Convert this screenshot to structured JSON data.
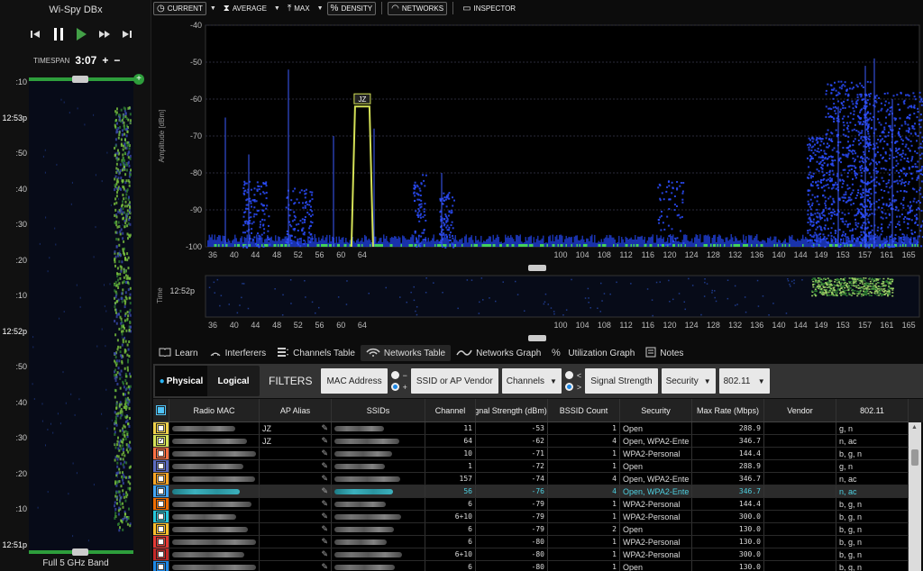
{
  "app": {
    "title": "Wi-Spy DBx"
  },
  "transport": {
    "prev": "skip-back",
    "pause": "pause",
    "play": "play",
    "ffwd": "fast-forward",
    "next": "skip-forward"
  },
  "timespan": {
    "label": "TIMESPAN",
    "value": "3:07",
    "plus": "+",
    "minus": "−"
  },
  "left_waterfall": {
    "time_labels": [
      ":10",
      "12:53p",
      ":50",
      ":40",
      ":30",
      ":20",
      ":10",
      "12:52p",
      ":50",
      ":40",
      ":30",
      ":20",
      ":10",
      "12:51p"
    ],
    "band_label": "Full 5 GHz Band"
  },
  "toolbar": {
    "current": "CURRENT",
    "average": "AVERAGE",
    "max": "MAX",
    "density": "DENSITY",
    "networks": "NETWORKS",
    "inspector": "INSPECTOR"
  },
  "spectrum": {
    "ylabel": "Amplitude [dBm]",
    "y_ticks": [
      "-40",
      "-50",
      "-60",
      "-70",
      "-80",
      "-90",
      "-100"
    ],
    "ylim": [
      -100,
      -40
    ],
    "x_ticks": [
      "36",
      "40",
      "44",
      "48",
      "52",
      "56",
      "60",
      "64",
      "100",
      "104",
      "108",
      "112",
      "116",
      "120",
      "124",
      "128",
      "132",
      "136",
      "140",
      "144",
      "149",
      "153",
      "157",
      "161",
      "165"
    ],
    "network_marker": {
      "label": "JZ",
      "channel": 64,
      "amplitude": -62
    }
  },
  "waterfall2": {
    "ylabel": "Time",
    "time_label": "12:52p"
  },
  "tabs": [
    {
      "label": "Learn",
      "icon": "book-icon"
    },
    {
      "label": "Interferers",
      "icon": "interferers-icon"
    },
    {
      "label": "Channels Table",
      "icon": "channels-table-icon"
    },
    {
      "label": "Networks Table",
      "icon": "wifi-icon"
    },
    {
      "label": "Networks Graph",
      "icon": "graph-icon"
    },
    {
      "label": "Utilization Graph",
      "icon": "utilization-icon"
    },
    {
      "label": "Notes",
      "icon": "notes-icon"
    }
  ],
  "filters": {
    "physical": "Physical",
    "logical": "Logical",
    "label": "FILTERS",
    "mac": "MAC Address",
    "radio1_a": "−",
    "radio1_b": "+",
    "ssid": "SSID or AP Vendor",
    "channels": "Channels",
    "radio2_a": "<",
    "radio2_b": ">",
    "signal": "Signal Strength",
    "security": "Security",
    "phy": "802.11"
  },
  "table": {
    "headers": [
      "Radio MAC",
      "AP Alias",
      "SSIDs",
      "Channel",
      "Signal Strength (dBm)",
      "BSSID Count",
      "Security",
      "Max Rate (Mbps)",
      "Vendor",
      "802.11"
    ],
    "rows": [
      {
        "color": "#f0d24a",
        "checked": false,
        "alias": "JZ",
        "channel": "11",
        "signal": "-53",
        "bssid": "1",
        "security": "Open",
        "rate": "288.9",
        "phy": "g, n"
      },
      {
        "color": "#d4e157",
        "checked": true,
        "alias": "JZ",
        "channel": "64",
        "signal": "-62",
        "bssid": "4",
        "security": "Open, WPA2-Ente",
        "rate": "346.7",
        "phy": "n, ac"
      },
      {
        "color": "#ff7043",
        "checked": false,
        "alias": "",
        "channel": "10",
        "signal": "-71",
        "bssid": "1",
        "security": "WPA2-Personal",
        "rate": "144.4",
        "phy": "b, g, n"
      },
      {
        "color": "#5c6bc0",
        "checked": false,
        "alias": "",
        "channel": "1",
        "signal": "-72",
        "bssid": "1",
        "security": "Open",
        "rate": "288.9",
        "phy": "g, n"
      },
      {
        "color": "#ffa726",
        "checked": false,
        "alias": "",
        "channel": "157",
        "signal": "-74",
        "bssid": "4",
        "security": "Open, WPA2-Ente",
        "rate": "346.7",
        "phy": "n, ac"
      },
      {
        "color": "#42a5f5",
        "checked": false,
        "alias": "",
        "channel": "56",
        "signal": "-76",
        "bssid": "4",
        "security": "Open, WPA2-Ente",
        "rate": "346.7",
        "phy": "n, ac",
        "highlight": true
      },
      {
        "color": "#ef6c00",
        "checked": false,
        "alias": "",
        "channel": "6",
        "signal": "-79",
        "bssid": "1",
        "security": "WPA2-Personal",
        "rate": "144.4",
        "phy": "b, g, n"
      },
      {
        "color": "#26c6da",
        "checked": false,
        "alias": "",
        "channel": "6+10",
        "signal": "-79",
        "bssid": "1",
        "security": "WPA2-Personal",
        "rate": "300.0",
        "phy": "b, g, n"
      },
      {
        "color": "#fbc02d",
        "checked": false,
        "alias": "",
        "channel": "6",
        "signal": "-79",
        "bssid": "2",
        "security": "Open",
        "rate": "130.0",
        "phy": "b, g, n"
      },
      {
        "color": "#e53935",
        "checked": false,
        "alias": "",
        "channel": "6",
        "signal": "-80",
        "bssid": "1",
        "security": "WPA2-Personal",
        "rate": "130.0",
        "phy": "b, g, n"
      },
      {
        "color": "#c62828",
        "checked": false,
        "alias": "",
        "channel": "6+10",
        "signal": "-80",
        "bssid": "1",
        "security": "WPA2-Personal",
        "rate": "300.0",
        "phy": "b, g, n"
      },
      {
        "color": "#1e88e5",
        "checked": false,
        "alias": "",
        "channel": "6",
        "signal": "-80",
        "bssid": "1",
        "security": "Open",
        "rate": "130.0",
        "phy": "b, g, n"
      }
    ]
  }
}
